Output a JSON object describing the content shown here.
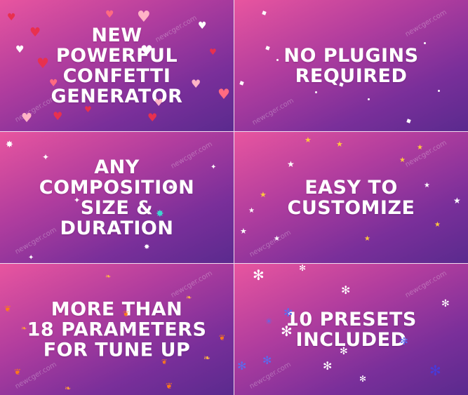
{
  "panels": [
    {
      "id": "new-generator",
      "lines": [
        "NEW",
        "POWERFUL",
        "CONFETTI",
        "GENERATOR"
      ]
    },
    {
      "id": "no-plugins",
      "lines": [
        "NO PLUGINS",
        "REQUIRED"
      ]
    },
    {
      "id": "any-size",
      "lines": [
        "ANY",
        "COMPOSITION",
        "SIZE &",
        "DURATION"
      ]
    },
    {
      "id": "easy-customize",
      "lines": [
        "EASY TO",
        "CUSTOMIZE"
      ]
    },
    {
      "id": "parameters",
      "lines": [
        "MORE THAN",
        "18 PARAMETERS",
        "FOR TUNE UP"
      ]
    },
    {
      "id": "presets",
      "lines": [
        "10 PRESETS",
        "INCLUDED"
      ]
    }
  ],
  "watermark": "newcger.com",
  "colors": {
    "gradient_start": "#e8559f",
    "gradient_end": "#5a2a8e",
    "text": "#ffffff",
    "divider": "#f2dcef",
    "heart_red": "#e8304f",
    "heart_pink": "#ffb3c6",
    "star_yellow": "#ffc83d",
    "star_teal": "#3fd6d0",
    "leaf_orange": "#ff7a1a",
    "snow_blue": "#5a6cf0"
  },
  "icons": {
    "heart": "heart-icon",
    "star": "star-icon",
    "leaf": "leaf-icon",
    "snowflake": "snowflake-icon"
  }
}
